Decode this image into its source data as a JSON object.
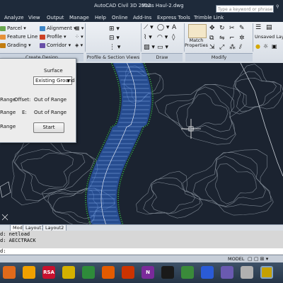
{
  "window": {
    "title": "AutoCAD Civil 3D 2012",
    "file": "Mass Haul-2.dwg",
    "search_placeholder": "Type a keyword or phrase"
  },
  "menubar": [
    "Analyze",
    "View",
    "Output",
    "Manage",
    "Help",
    "Online",
    "Add-Ins",
    "Express Tools",
    "Trimble Link"
  ],
  "ribbon": {
    "create_design": {
      "parcel": "Parcel",
      "alignment": "Alignment",
      "feature_line": "Feature Line",
      "profile": "Profile",
      "grading": "Grading",
      "corridor": "Corridor",
      "panel_label": "Create Design"
    },
    "profile_section_views_label": "Profile & Section Views",
    "draw_label": "Draw",
    "modify": {
      "match_properties": "Match\nProperties",
      "panel_label": "Modify"
    },
    "unsaved_layer": "Unsaved Laye"
  },
  "dialog": {
    "surface_label": "Surface",
    "surface_value": "Existing Ground",
    "range_label_1": "Range",
    "offset_label": "Offset:",
    "offset_value": "Out of Range",
    "range_label_2": "Range",
    "e_label": "E:",
    "e_value": "Out of Range",
    "range_label_3": "Range",
    "start_button": "Start"
  },
  "layout_tabs": [
    "Model",
    "Layout1",
    "Layout2"
  ],
  "command_lines": [
    "d: netload",
    "d: AECCTRACK",
    "d:"
  ],
  "status": {
    "model": "MODEL"
  },
  "taskbar": {
    "apps": [
      {
        "label": "",
        "color": "#e06a1a"
      },
      {
        "label": "",
        "color": "#f0a000"
      },
      {
        "label": "RSA",
        "color": "#c8102e"
      },
      {
        "label": "",
        "color": "#d4b000"
      },
      {
        "label": "",
        "color": "#2e8b3a"
      },
      {
        "label": "",
        "color": "#e35b00"
      },
      {
        "label": "",
        "color": "#cc3300"
      },
      {
        "label": "N",
        "color": "#7a2a9a"
      },
      {
        "label": "",
        "color": "#1a1a1a"
      },
      {
        "label": "",
        "color": "#3a8a3a"
      },
      {
        "label": "",
        "color": "#2a5bd7"
      },
      {
        "label": "",
        "color": "#6a5ab0"
      },
      {
        "label": "",
        "color": "#b0b0b0"
      },
      {
        "label": "",
        "color": "#c4a000"
      }
    ]
  },
  "colors": {
    "canvas_bg": "#1b2330",
    "contour": "#9aa3ad",
    "corridor_blue": "#2f6fdf",
    "corridor_green": "#34c34a"
  }
}
